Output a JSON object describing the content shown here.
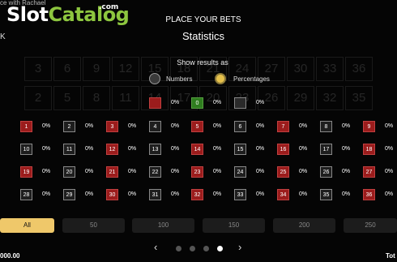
{
  "brand": {
    "slot": "Slot",
    "catalog": "Catalog",
    "com": ".com"
  },
  "topleft_text": "ce with Rachael",
  "left_edge_text": "K",
  "header": {
    "line1": "PLACE YOUR BETS",
    "title": "Statistics"
  },
  "show_results": {
    "label": "Show results as",
    "options": [
      "Numbers",
      "Percentages"
    ],
    "selected": "Percentages"
  },
  "special_cells": [
    {
      "number": "",
      "color": "red",
      "pct": "0%"
    },
    {
      "number": "0",
      "color": "green",
      "pct": "0%"
    },
    {
      "number": "",
      "color": "gray",
      "pct": "0%"
    }
  ],
  "numbers": [
    [
      {
        "n": "1",
        "c": "red",
        "p": "0%"
      },
      {
        "n": "2",
        "c": "black",
        "p": "0%"
      },
      {
        "n": "3",
        "c": "red",
        "p": "0%"
      },
      {
        "n": "4",
        "c": "black",
        "p": "0%"
      },
      {
        "n": "5",
        "c": "red",
        "p": "0%"
      },
      {
        "n": "6",
        "c": "black",
        "p": "0%"
      },
      {
        "n": "7",
        "c": "red",
        "p": "0%"
      },
      {
        "n": "8",
        "c": "black",
        "p": "0%"
      },
      {
        "n": "9",
        "c": "red",
        "p": "0%"
      }
    ],
    [
      {
        "n": "10",
        "c": "black",
        "p": "0%"
      },
      {
        "n": "11",
        "c": "black",
        "p": "0%"
      },
      {
        "n": "12",
        "c": "red",
        "p": "0%"
      },
      {
        "n": "13",
        "c": "black",
        "p": "0%"
      },
      {
        "n": "14",
        "c": "red",
        "p": "0%"
      },
      {
        "n": "15",
        "c": "black",
        "p": "0%"
      },
      {
        "n": "16",
        "c": "red",
        "p": "0%"
      },
      {
        "n": "17",
        "c": "black",
        "p": "0%"
      },
      {
        "n": "18",
        "c": "red",
        "p": "0%"
      }
    ],
    [
      {
        "n": "19",
        "c": "red",
        "p": "0%"
      },
      {
        "n": "20",
        "c": "black",
        "p": "0%"
      },
      {
        "n": "21",
        "c": "red",
        "p": "0%"
      },
      {
        "n": "22",
        "c": "black",
        "p": "0%"
      },
      {
        "n": "23",
        "c": "red",
        "p": "0%"
      },
      {
        "n": "24",
        "c": "black",
        "p": "0%"
      },
      {
        "n": "25",
        "c": "red",
        "p": "0%"
      },
      {
        "n": "26",
        "c": "black",
        "p": "0%"
      },
      {
        "n": "27",
        "c": "red",
        "p": "0%"
      }
    ],
    [
      {
        "n": "28",
        "c": "black",
        "p": "0%"
      },
      {
        "n": "29",
        "c": "black",
        "p": "0%"
      },
      {
        "n": "30",
        "c": "red",
        "p": "0%"
      },
      {
        "n": "31",
        "c": "black",
        "p": "0%"
      },
      {
        "n": "32",
        "c": "red",
        "p": "0%"
      },
      {
        "n": "33",
        "c": "black",
        "p": "0%"
      },
      {
        "n": "34",
        "c": "red",
        "p": "0%"
      },
      {
        "n": "35",
        "c": "black",
        "p": "0%"
      },
      {
        "n": "36",
        "c": "red",
        "p": "0%"
      }
    ]
  ],
  "filters": [
    "All",
    "50",
    "100",
    "150",
    "200",
    "250"
  ],
  "active_filter": "All",
  "pager": {
    "prev": "‹",
    "next": "›",
    "pages": 4,
    "current_page": 4
  },
  "balance_left": "000.00",
  "total_label": "Tot",
  "background_numbers": [
    "3",
    "6",
    "9",
    "12",
    "15",
    "18",
    "21",
    "24",
    "27",
    "30",
    "33",
    "36",
    "2",
    "5",
    "8",
    "11",
    "14",
    "17",
    "20",
    "23",
    "26",
    "29",
    "32",
    "35"
  ],
  "colors": {
    "red": "#9b1c1c",
    "green": "#2f7d1f",
    "gold": "#efc86a",
    "brand_green": "#8dc63f"
  }
}
